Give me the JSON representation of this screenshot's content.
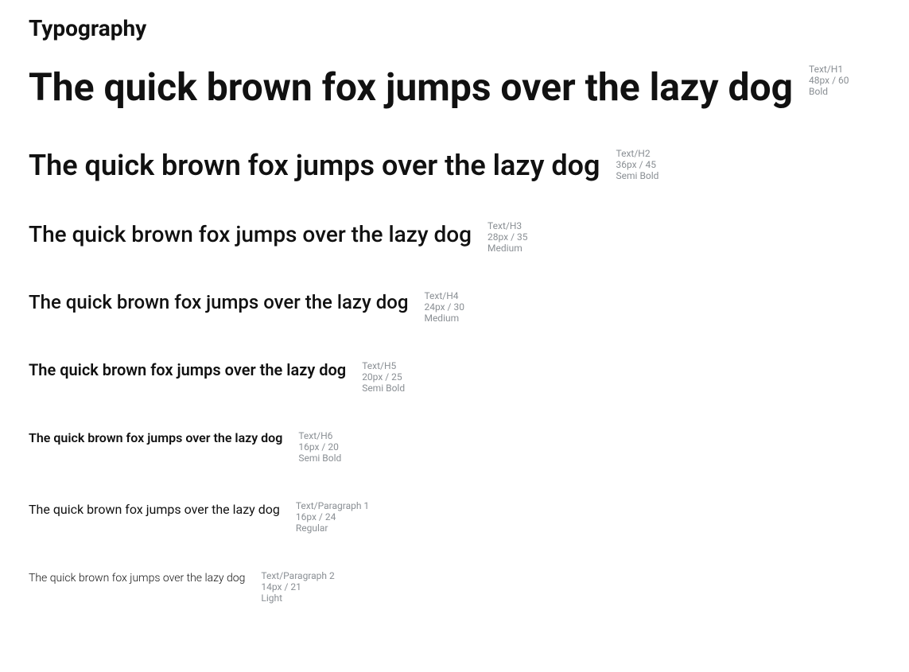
{
  "title": "Typography",
  "sample_text": "The quick brown fox jumps over the lazy dog",
  "styles": [
    {
      "class": "h1",
      "name": "Text/H1",
      "size": "48px / 60",
      "weight": "Bold"
    },
    {
      "class": "h2",
      "name": "Text/H2",
      "size": "36px / 45",
      "weight": "Semi Bold"
    },
    {
      "class": "h3",
      "name": "Text/H3",
      "size": "28px / 35",
      "weight": "Medium"
    },
    {
      "class": "h4",
      "name": "Text/H4",
      "size": "24px / 30",
      "weight": "Medium"
    },
    {
      "class": "h5",
      "name": "Text/H5",
      "size": "20px / 25",
      "weight": "Semi Bold"
    },
    {
      "class": "h6",
      "name": "Text/H6",
      "size": "16px / 20",
      "weight": "Semi Bold"
    },
    {
      "class": "p1",
      "name": "Text/Paragraph 1",
      "size": "16px / 24",
      "weight": "Regular"
    },
    {
      "class": "p2",
      "name": "Text/Paragraph 2",
      "size": "14px / 21",
      "weight": "Light"
    }
  ]
}
